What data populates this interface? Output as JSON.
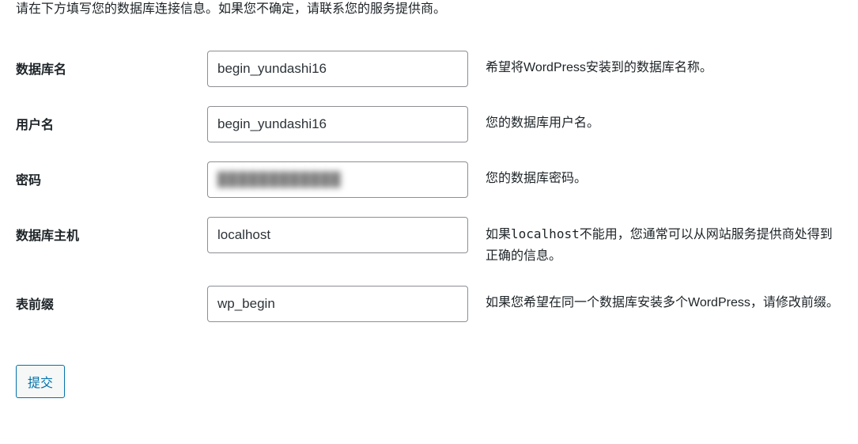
{
  "intro": "请在下方填写您的数据库连接信息。如果您不确定，请联系您的服务提供商。",
  "fields": {
    "dbname": {
      "label": "数据库名",
      "value": "begin_yundashi16",
      "desc": "希望将WordPress安装到的数据库名称。"
    },
    "username": {
      "label": "用户名",
      "value": "begin_yundashi16",
      "desc": "您的数据库用户名。"
    },
    "password": {
      "label": "密码",
      "value": "",
      "desc": "您的数据库密码。"
    },
    "dbhost": {
      "label": "数据库主机",
      "value": "localhost",
      "desc_prefix": "如果",
      "desc_code": "localhost",
      "desc_suffix": "不能用，您通常可以从网站服务提供商处得到正确的信息。"
    },
    "prefix": {
      "label": "表前缀",
      "value": "wp_begin",
      "desc": "如果您希望在同一个数据库安装多个WordPress，请修改前缀。"
    }
  },
  "submit": {
    "label": "提交"
  }
}
